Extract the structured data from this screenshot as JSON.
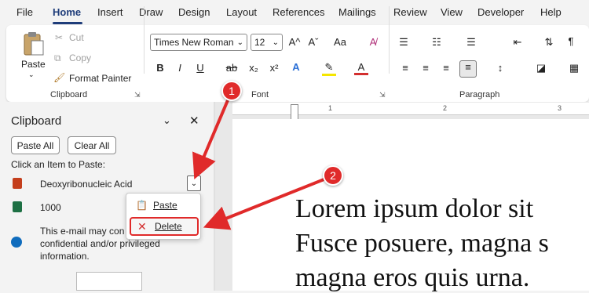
{
  "menu": {
    "items": [
      "File",
      "Home",
      "Insert",
      "Draw",
      "Design",
      "Layout",
      "References",
      "Mailings",
      "Review",
      "View",
      "Developer",
      "Help"
    ],
    "active": "Home"
  },
  "clipboard_group": {
    "paste_label": "Paste",
    "cut_label": "Cut",
    "copy_label": "Copy",
    "format_painter_label": "Format Painter",
    "group_label": "Clipboard"
  },
  "font_group": {
    "font_name": "Times New Roman",
    "font_size": "12",
    "group_label": "Font",
    "bold": "B",
    "italic": "I",
    "underline": "U",
    "strike": "ab",
    "subscript": "x₂",
    "superscript": "x²",
    "grow": "A^",
    "shrink": "Aˇ",
    "case": "Aa",
    "text_effects": "A",
    "highlight": "✎",
    "font_color": "A"
  },
  "paragraph_group": {
    "group_label": "Paragraph",
    "pilcrow": "¶"
  },
  "pane": {
    "title": "Clipboard",
    "paste_all": "Paste All",
    "clear_all": "Clear All",
    "instruction": "Click an Item to Paste:",
    "items": [
      {
        "text": "Deoxyribonucleic Acid",
        "app": "powerpoint"
      },
      {
        "text": "1000",
        "app": "excel"
      },
      {
        "text_lines": [
          "This e-mail may con",
          "confidential and/or privileged",
          "information."
        ],
        "app": "outlook"
      }
    ]
  },
  "item_menu": {
    "paste": "Paste",
    "delete": "Delete"
  },
  "document": {
    "lines": [
      "Lorem ipsum dolor sit",
      "Fusce posuere, magna s",
      "magna eros quis urna."
    ]
  },
  "ruler": {
    "marks": [
      "1",
      "2",
      "3"
    ]
  },
  "callouts": [
    "1",
    "2"
  ],
  "colors": {
    "accent": "#1f3d7a",
    "callout_red": "#e02a2a",
    "highlight_yellow": "#f5e600",
    "font_red": "#d32f2f"
  }
}
